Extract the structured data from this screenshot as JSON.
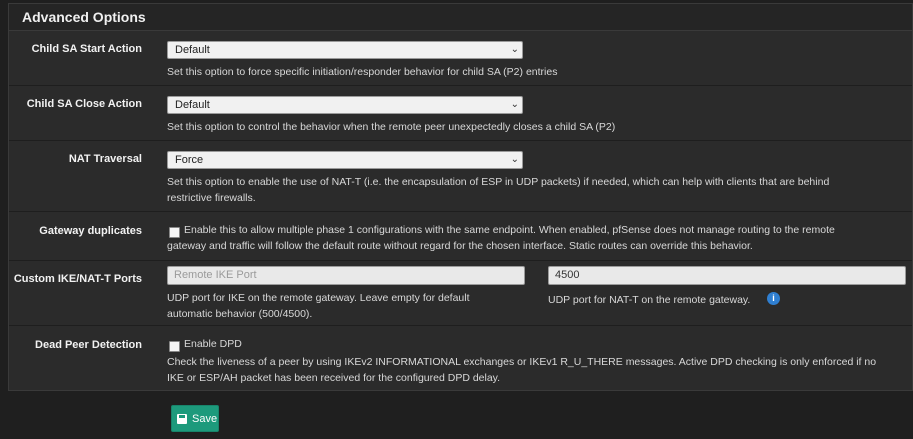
{
  "panel": {
    "title": "Advanced Options"
  },
  "rows": {
    "child_sa_start": {
      "label": "Child SA Start Action",
      "value": "Default",
      "help": "Set this option to force specific initiation/responder behavior for child SA (P2) entries"
    },
    "child_sa_close": {
      "label": "Child SA Close Action",
      "value": "Default",
      "help": "Set this option to control the behavior when the remote peer unexpectedly closes a child SA (P2)"
    },
    "nat_traversal": {
      "label": "NAT Traversal",
      "value": "Force",
      "help_line1": "Set this option to enable the use of NAT-T (i.e. the encapsulation of ESP in UDP packets) if needed, which can help with clients that are behind",
      "help_line2": "restrictive firewalls."
    },
    "gateway_duplicates": {
      "label": "Gateway duplicates",
      "checked": false,
      "help_line1": "Enable this to allow multiple phase 1 configurations with the same endpoint. When enabled, pfSense does not manage routing to the remote",
      "help_line2": "gateway and traffic will follow the default route without regard for the chosen interface. Static routes can override this behavior."
    },
    "custom_ports": {
      "label": "Custom IKE/NAT-T Ports",
      "ike_placeholder": "Remote IKE Port",
      "ike_value": "",
      "ike_help_line1": "UDP port for IKE on the remote gateway. Leave empty for default",
      "ike_help_line2": "automatic behavior (500/4500).",
      "natt_value": "4500",
      "natt_help": "UDP port for NAT-T on the remote gateway."
    },
    "dpd": {
      "label": "Dead Peer Detection",
      "checkbox_label": "Enable DPD",
      "checked": false,
      "help_line1": "Check the liveness of a peer by using IKEv2 INFORMATIONAL exchanges or IKEv1 R_U_THERE messages. Active DPD checking is only enforced if no",
      "help_line2": "IKE or ESP/AH packet has been received for the configured DPD delay."
    }
  },
  "save_button": {
    "label": "Save"
  }
}
